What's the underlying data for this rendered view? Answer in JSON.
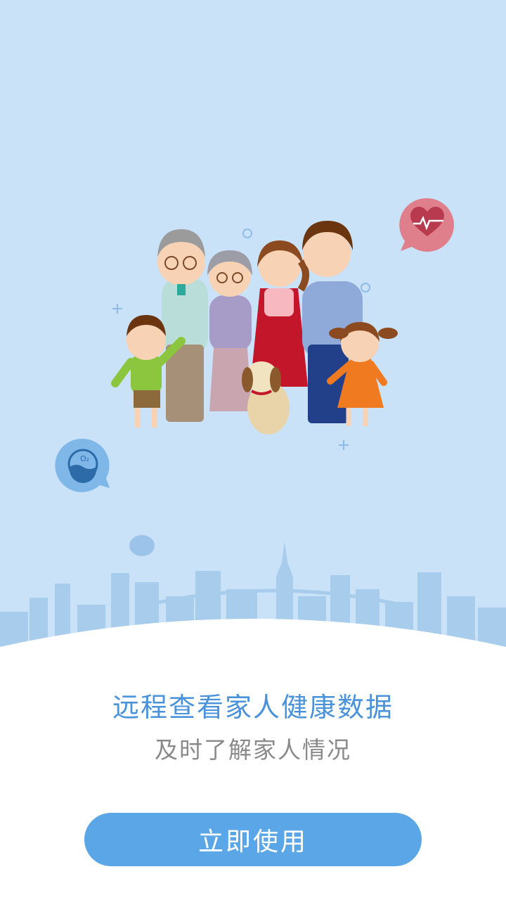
{
  "onboarding": {
    "headline": "远程查看家人健康数据",
    "subline": "及时了解家人情况",
    "cta_label": "立即使用"
  },
  "badges": {
    "heart": "heart-rate-icon",
    "oxygen": "oxygen-icon",
    "oxygen_label": "O₂"
  },
  "colors": {
    "background": "#c9e2f8",
    "skyline": "#a7ccec",
    "accent_text": "#4a92d9",
    "secondary_text": "#8a8a8a",
    "button": "#5aa6e6",
    "heart_badge": "#e07f8c",
    "oxygen_badge": "#7fb7e8"
  }
}
